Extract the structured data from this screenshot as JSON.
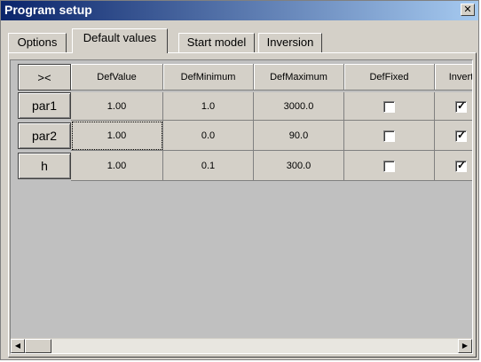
{
  "window": {
    "title": "Program setup",
    "close_glyph": "✕",
    "close_icon": "close-icon"
  },
  "tabs": [
    {
      "label": "Options",
      "active": false
    },
    {
      "label": "Default values",
      "active": true
    },
    {
      "label": "Start model",
      "active": false
    },
    {
      "label": "Inversion",
      "active": false
    }
  ],
  "grid": {
    "corner_label": "><",
    "columns": [
      "DefValue",
      "DefMinimum",
      "DefMaximum",
      "DefFixed",
      "Invert"
    ],
    "rows": [
      {
        "name": "par1",
        "def_value": "1.00",
        "def_minimum": "1.0",
        "def_maximum": "3000.0",
        "def_fixed": false,
        "invert": true
      },
      {
        "name": "par2",
        "def_value": "1.00",
        "def_minimum": "0.0",
        "def_maximum": "90.0",
        "def_fixed": false,
        "invert": true
      },
      {
        "name": "h",
        "def_value": "1.00",
        "def_minimum": "0.1",
        "def_maximum": "300.0",
        "def_fixed": false,
        "invert": true
      }
    ],
    "focused_cell": "par2.def_value",
    "check_glyph": "✓"
  },
  "scrollbar": {
    "left_glyph": "◀",
    "right_glyph": "▶"
  }
}
